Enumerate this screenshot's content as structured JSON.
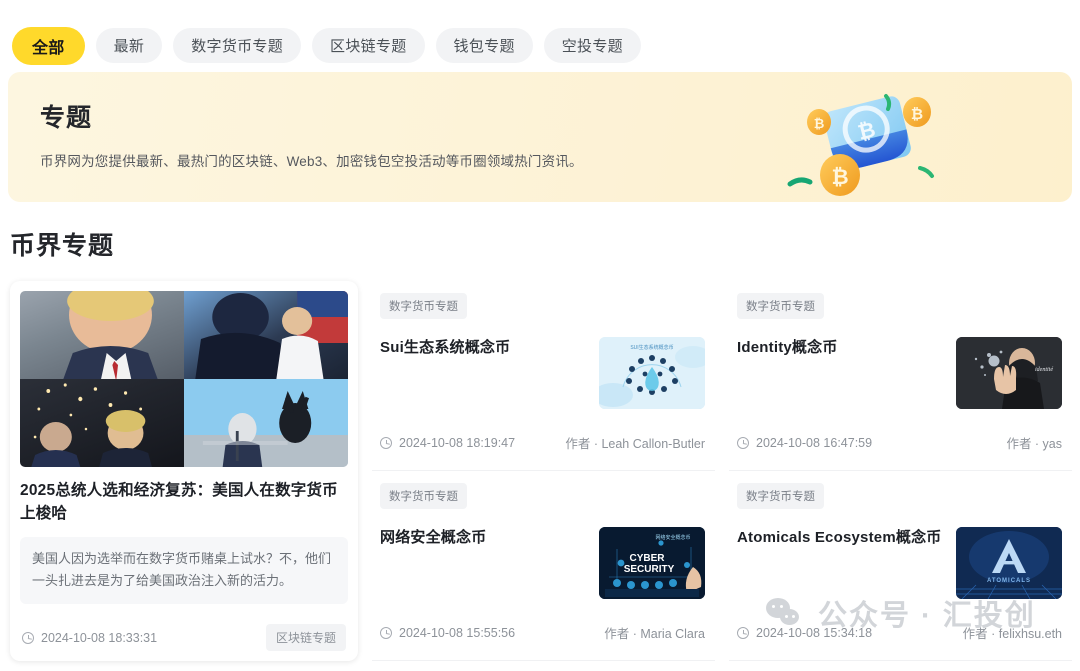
{
  "tabs": [
    {
      "label": "全部",
      "active": true
    },
    {
      "label": "最新",
      "active": false
    },
    {
      "label": "数字货币专题",
      "active": false
    },
    {
      "label": "区块链专题",
      "active": false
    },
    {
      "label": "钱包专题",
      "active": false
    },
    {
      "label": "空投专题",
      "active": false
    }
  ],
  "banner": {
    "title": "专题",
    "subtitle": "币界网为您提供最新、最热门的区块链、Web3、加密钱包空投活动等币圈领域热门资讯。",
    "art_icon": "blue-cube-with-bitcoin-coins",
    "bg_color": "#fdf3d8"
  },
  "section": {
    "title": "币界专题"
  },
  "featured": {
    "title": "2025总统人选和经济复苏：美国人在数字货币上梭哈",
    "excerpt": "美国人因为选举而在数字货币赌桌上试水？不，他们一头扎进去是为了给美国政治注入新的活力。",
    "time": "2024-10-08 18:33:31",
    "tag": "区块链专题",
    "collage_alt": [
      "trump-portrait",
      "trump-secret-service",
      "trump-with-rfk-sparks",
      "trump-rally-stage"
    ]
  },
  "articles": [
    {
      "tag": "数字货币专题",
      "title": "Sui生态系统概念币",
      "time": "2024-10-08 18:19:47",
      "author": "作者 · Leah Callon-Butler",
      "thumb": "sui-ecosystem-light-blue",
      "thumb_text": "SUI生态系统概念币"
    },
    {
      "tag": "数字货币专题",
      "title": "Identity概念币",
      "time": "2024-10-08 16:47:59",
      "author": "作者 · yas",
      "thumb": "identity-dark-portrait",
      "thumb_text": "identité"
    },
    {
      "tag": "数字货币专题",
      "title": "网络安全概念币",
      "time": "2024-10-08 15:55:56",
      "author": "作者 · Maria Clara",
      "thumb": "cyber-security-dark-blue",
      "thumb_text": "CYBER SECURITY"
    },
    {
      "tag": "数字货币专题",
      "title": "Atomicals Ecosystem概念币",
      "time": "2024-10-08 15:34:18",
      "author": "作者 · felixhsu.eth",
      "thumb": "atomicals-logo-navy",
      "thumb_text": "ATOMICALS"
    }
  ],
  "watermark": {
    "text": "公众号 · 汇投创",
    "icon": "wechat-bubbles-icon"
  },
  "colors": {
    "accent": "#ffd92b",
    "tag_bg": "#f2f3f5",
    "text": "#1d2026",
    "muted": "#8d9299"
  }
}
